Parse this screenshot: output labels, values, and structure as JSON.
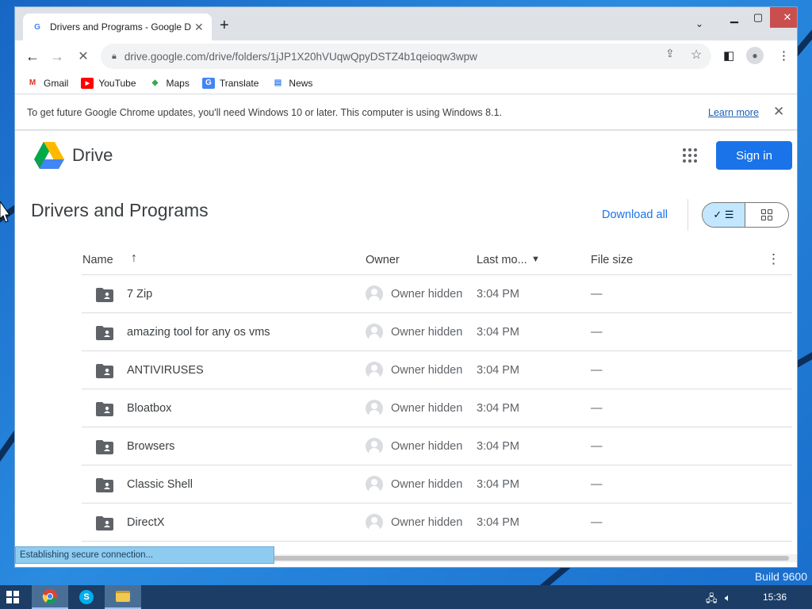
{
  "desktop": {
    "build_label": "Build 9600"
  },
  "browser": {
    "tab_title": "Drivers and Programs - Google Drive",
    "tab_favicon_text": "G",
    "new_tab_symbol": "+",
    "url": "drive.google.com/drive/folders/1jJP1X20hVUqwQpyDSTZ4b1qeioqw3wpw",
    "bookmarks": [
      {
        "label": "Gmail",
        "icon": "gmail-icon",
        "icon_text": "M",
        "color": "#d93025"
      },
      {
        "label": "YouTube",
        "icon": "youtube-icon",
        "icon_text": "▶",
        "color": "#ff0000"
      },
      {
        "label": "Maps",
        "icon": "maps-icon",
        "icon_text": "◆",
        "color": "#34a853"
      },
      {
        "label": "Translate",
        "icon": "translate-icon",
        "icon_text": "G",
        "color": "#4285f4"
      },
      {
        "label": "News",
        "icon": "news-icon",
        "icon_text": "▤",
        "color": "#4285f4"
      }
    ],
    "infobar": {
      "message": "To get future Google Chrome updates, you'll need Windows 10 or later. This computer is using Windows 8.1.",
      "learn_more": "Learn more"
    },
    "status_text": "Establishing secure connection..."
  },
  "drive": {
    "logo_text": "Drive",
    "sign_in": "Sign in",
    "folder_title": "Drivers and Programs",
    "download_all": "Download all",
    "columns": {
      "name": "Name",
      "owner": "Owner",
      "modified": "Last mo...",
      "size": "File size"
    },
    "rows": [
      {
        "name": "7 Zip",
        "owner": "Owner hidden",
        "modified": "3:04 PM",
        "size": "—"
      },
      {
        "name": "amazing tool for any os vms",
        "owner": "Owner hidden",
        "modified": "3:04 PM",
        "size": "—"
      },
      {
        "name": "ANTIVIRUSES",
        "owner": "Owner hidden",
        "modified": "3:04 PM",
        "size": "—"
      },
      {
        "name": "Bloatbox",
        "owner": "Owner hidden",
        "modified": "3:04 PM",
        "size": "—"
      },
      {
        "name": "Browsers",
        "owner": "Owner hidden",
        "modified": "3:04 PM",
        "size": "—"
      },
      {
        "name": "Classic Shell",
        "owner": "Owner hidden",
        "modified": "3:04 PM",
        "size": "—"
      },
      {
        "name": "DirectX",
        "owner": "Owner hidden",
        "modified": "3:04 PM",
        "size": "—"
      }
    ]
  },
  "taskbar": {
    "clock": "15:36"
  },
  "colors": {
    "accent": "#1a73e8",
    "desktop": "#1e7fd6",
    "taskbar": "#1b3d66"
  }
}
